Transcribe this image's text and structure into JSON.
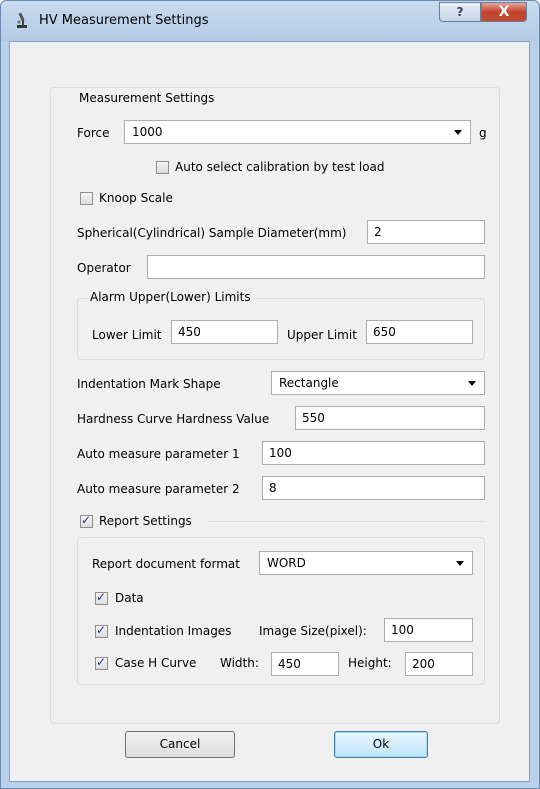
{
  "window": {
    "title": "HV Measurement Settings",
    "help_label": "?",
    "close_label": "X"
  },
  "measurement": {
    "group_title": "Measurement Settings",
    "force_label": "Force",
    "force_value": "1000",
    "force_unit": "g",
    "auto_calib_label": "Auto select calibration by test load",
    "auto_calib_checked": false,
    "knoop_label": "Knoop Scale",
    "knoop_checked": false,
    "diameter_label": "Spherical(Cylindrical) Sample Diameter(mm)",
    "diameter_value": "2",
    "operator_label": "Operator",
    "operator_value": ""
  },
  "alarm": {
    "group_title": "Alarm Upper(Lower) Limits",
    "lower_label": "Lower Limit",
    "lower_value": "450",
    "upper_label": "Upper Limit",
    "upper_value": "650"
  },
  "shape": {
    "label": "Indentation Mark Shape",
    "value": "Rectangle"
  },
  "curve": {
    "label": "Hardness Curve Hardness Value",
    "value": "550"
  },
  "auto1": {
    "label": "Auto measure parameter 1",
    "value": "100"
  },
  "auto2": {
    "label": "Auto measure parameter 2",
    "value": "8"
  },
  "report": {
    "group_title": "Report Settings",
    "enabled": true,
    "format_label": "Report document format",
    "format_value": "WORD",
    "data_label": "Data",
    "data_checked": true,
    "images_label": "Indentation Images",
    "images_checked": true,
    "image_size_label": "Image Size(pixel):",
    "image_size_value": "100",
    "case_label": "Case H Curve",
    "case_checked": true,
    "width_label": "Width:",
    "width_value": "450",
    "height_label": "Height:",
    "height_value": "200"
  },
  "buttons": {
    "cancel": "Cancel",
    "ok": "Ok"
  }
}
